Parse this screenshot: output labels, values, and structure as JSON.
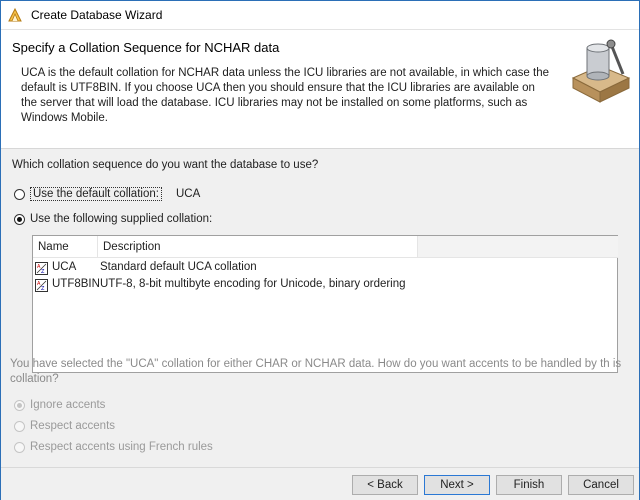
{
  "window": {
    "title": "Create Database Wizard"
  },
  "header": {
    "title": "Specify a Collation Sequence for NCHAR data",
    "description": "UCA is the default collation for NCHAR data unless the ICU libraries are not available, in which case the default is UTF8BIN. If you choose UCA then you should ensure that the ICU libraries are available on the server that will load the database. ICU libraries may not be installed on some platforms, such as Windows Mobile."
  },
  "question": "Which collation sequence do you want the database to use?",
  "options": {
    "default": {
      "label": "Use the default collation:",
      "value": "UCA",
      "selected": false
    },
    "supplied": {
      "label": "Use the following supplied collation:",
      "selected": true
    }
  },
  "collation_list": {
    "columns": [
      "Name",
      "Description"
    ],
    "rows": [
      {
        "name": "UCA",
        "description": "Standard default UCA collation"
      },
      {
        "name": "UTF8BIN",
        "description": "UTF-8, 8-bit multibyte encoding for Unicode, binary ordering"
      }
    ]
  },
  "accents": {
    "question": "You have selected the \"UCA\" collation for either CHAR or NCHAR data. How do you want accents to be handled by th is collation?",
    "options": [
      {
        "label": "Ignore accents",
        "selected": true,
        "enabled": false
      },
      {
        "label": "Respect accents",
        "selected": false,
        "enabled": false
      },
      {
        "label": "Respect accents using French rules",
        "selected": false,
        "enabled": false
      }
    ]
  },
  "buttons": {
    "back": "< Back",
    "next": "Next >",
    "finish": "Finish",
    "cancel": "Cancel"
  },
  "colors": {
    "accent": "#2b78d4",
    "window_border": "#2b6fb7",
    "disabled_text": "#9a9a9a"
  }
}
